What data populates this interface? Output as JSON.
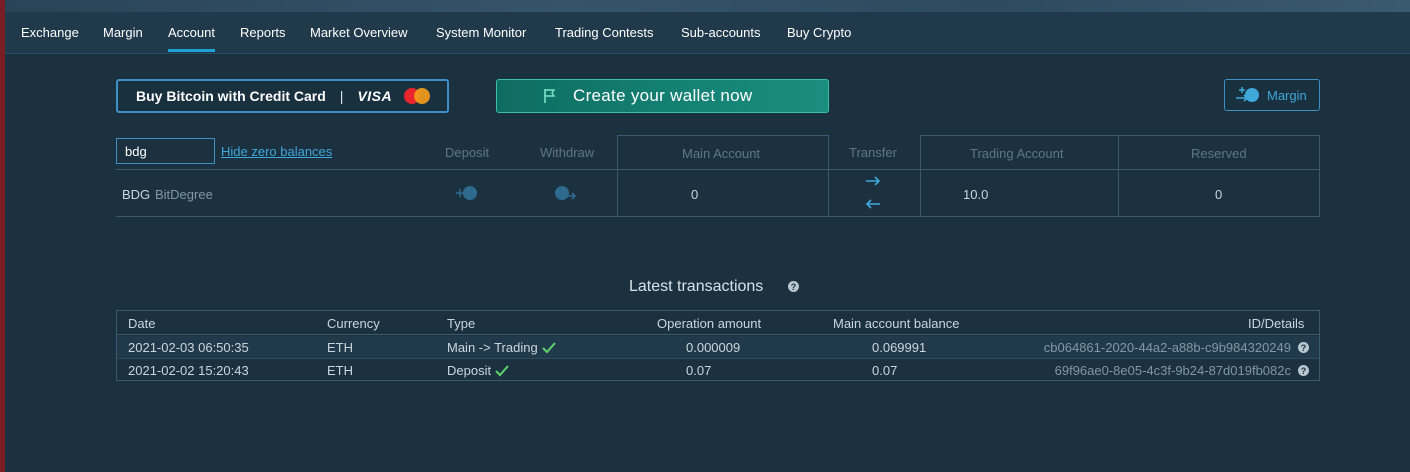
{
  "nav": {
    "items": [
      {
        "label": "Exchange"
      },
      {
        "label": "Margin"
      },
      {
        "label": "Account"
      },
      {
        "label": "Reports"
      },
      {
        "label": "Market Overview"
      },
      {
        "label": "System Monitor"
      },
      {
        "label": "Trading Contests"
      },
      {
        "label": "Sub-accounts"
      },
      {
        "label": "Buy Crypto"
      }
    ],
    "active": "Account"
  },
  "actions": {
    "buy_label": "Buy Bitcoin with Credit Card",
    "buy_separator": "|",
    "visa_label": "VISA",
    "wallet_label": "Create your wallet now",
    "margin_label": "Margin"
  },
  "filter": {
    "value": "bdg",
    "hide_zero_label": "Hide zero balances"
  },
  "balances": {
    "headers": {
      "deposit": "Deposit",
      "withdraw": "Withdraw",
      "main_account": "Main Account",
      "transfer": "Transfer",
      "trading_account": "Trading Account",
      "reserved": "Reserved"
    },
    "rows": [
      {
        "code": "BDG",
        "name": "BitDegree",
        "main": "0",
        "trading": "10.0",
        "reserved": "0"
      }
    ]
  },
  "transactions": {
    "title": "Latest transactions",
    "headers": {
      "date": "Date",
      "currency": "Currency",
      "type": "Type",
      "amount": "Operation amount",
      "balance": "Main account balance",
      "id": "ID/Details"
    },
    "rows": [
      {
        "date": "2021-02-03 06:50:35",
        "currency": "ETH",
        "type": "Main -> Trading",
        "amount": "0.000009",
        "balance": "0.069991",
        "id": "cb064861-2020-44a2-a88b-c9b984320249"
      },
      {
        "date": "2021-02-02 15:20:43",
        "currency": "ETH",
        "type": "Deposit",
        "amount": "0.07",
        "balance": "0.07",
        "id": "69f96ae0-8e05-4c3f-9b24-87d019fb082c"
      }
    ]
  },
  "colors": {
    "background": "#1c3140",
    "accent": "#1fa3d6",
    "wallet_button": "#137f72",
    "success": "#5fd36a"
  }
}
